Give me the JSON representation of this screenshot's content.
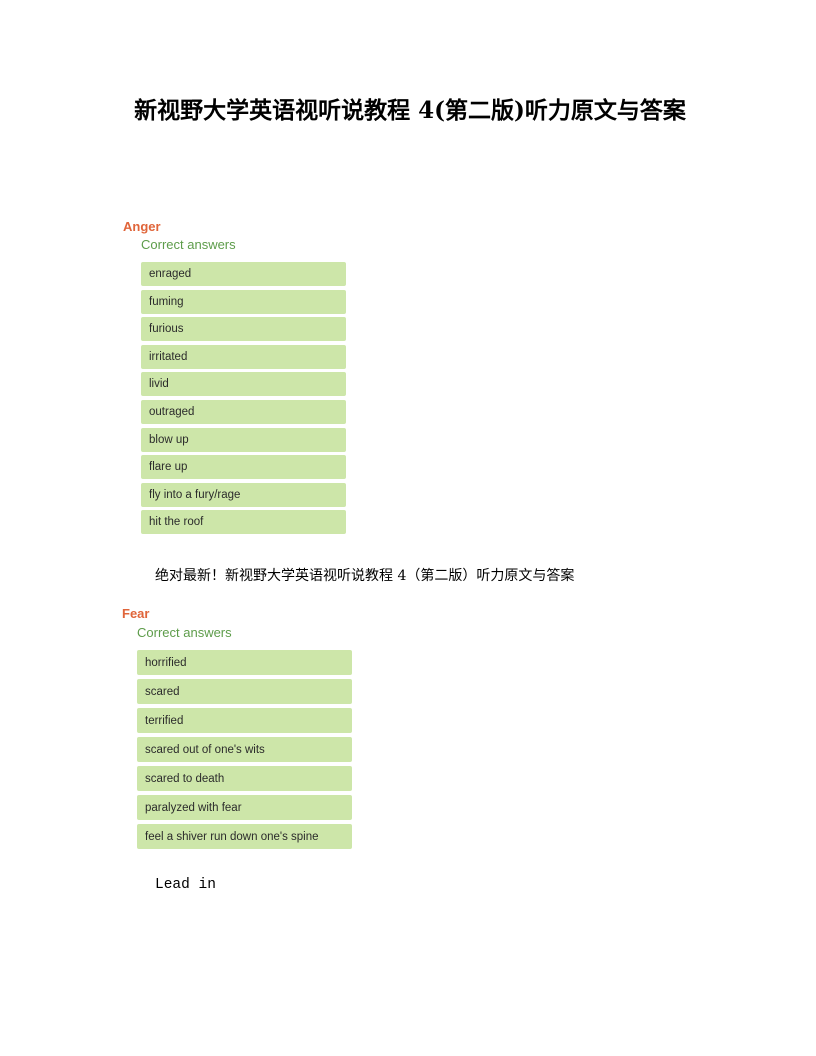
{
  "document": {
    "title": "新视野大学英语视听说教程 4(第二版)听力原文与答案"
  },
  "anger": {
    "heading": "Anger",
    "subheading": "Correct answers",
    "answers": [
      "enraged",
      "fuming",
      "furious",
      "irritated",
      "livid",
      "outraged",
      "blow up",
      "flare up",
      "fly into a fury/rage",
      "hit the roof"
    ]
  },
  "body_text": "绝对最新！新视野大学英语视听说教程 4（第二版）听力原文与答案",
  "fear": {
    "heading": "Fear",
    "subheading": "Correct answers",
    "answers": [
      "horrified",
      "scared",
      "terrified",
      "scared out of one's wits",
      "scared to death",
      "paralyzed with fear",
      "feel a shiver run down one's spine"
    ]
  },
  "lead_in": "Lead in",
  "colors": {
    "heading": "#e0653a",
    "subheading": "#5d9c4a",
    "answer_bg": "#cde6a9"
  }
}
